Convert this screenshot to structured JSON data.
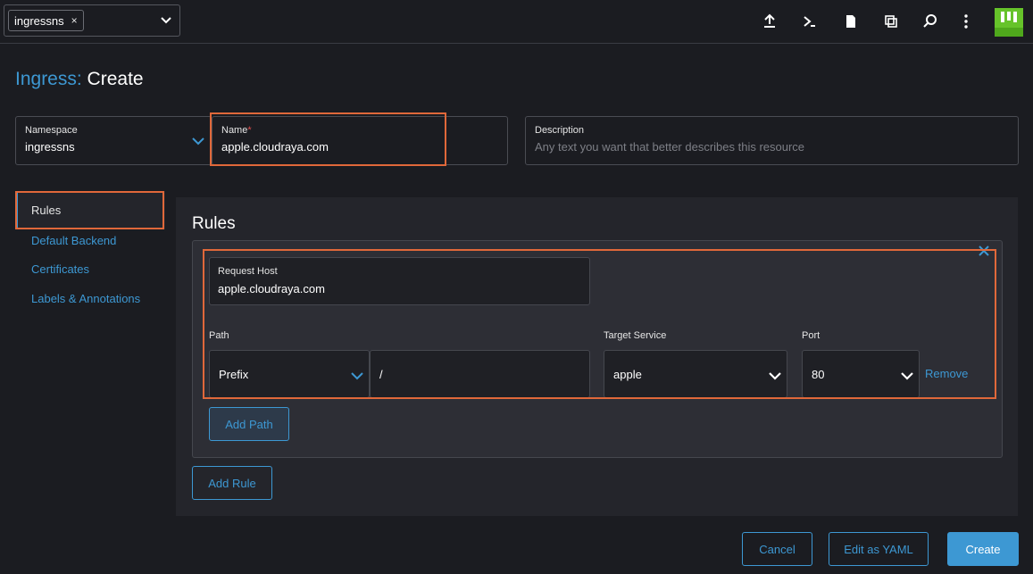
{
  "topbar": {
    "namespace_chip": "ingressns",
    "chip_remove": "×",
    "icons": [
      "upload-icon",
      "terminal-icon",
      "file-icon",
      "copy-icon",
      "search-icon",
      "more-icon"
    ]
  },
  "page": {
    "kind_label": "Ingress:",
    "action_label": "Create"
  },
  "form": {
    "namespace": {
      "label": "Namespace",
      "value": "ingressns"
    },
    "name": {
      "label": "Name",
      "required_mark": "*",
      "value": "apple.cloudraya.com"
    },
    "description": {
      "label": "Description",
      "placeholder": "Any text you want that better describes this resource"
    }
  },
  "sidebar": {
    "items": [
      {
        "label": "Rules",
        "active": true
      },
      {
        "label": "Default Backend"
      },
      {
        "label": "Certificates"
      },
      {
        "label": "Labels & Annotations"
      }
    ]
  },
  "rules": {
    "heading": "Rules",
    "rule": {
      "request_host": {
        "label": "Request Host",
        "value": "apple.cloudraya.com"
      },
      "path": {
        "label": "Path",
        "type": "Prefix",
        "value": "/"
      },
      "target_service": {
        "label": "Target Service",
        "value": "apple"
      },
      "port": {
        "label": "Port",
        "value": "80"
      },
      "remove_label": "Remove",
      "add_path_label": "Add Path"
    },
    "add_rule_label": "Add Rule"
  },
  "footer": {
    "cancel_label": "Cancel",
    "edit_yaml_label": "Edit as YAML",
    "create_label": "Create"
  },
  "colors": {
    "accent": "#3d98d3",
    "highlight": "#e0683a",
    "background": "#1b1c21"
  }
}
